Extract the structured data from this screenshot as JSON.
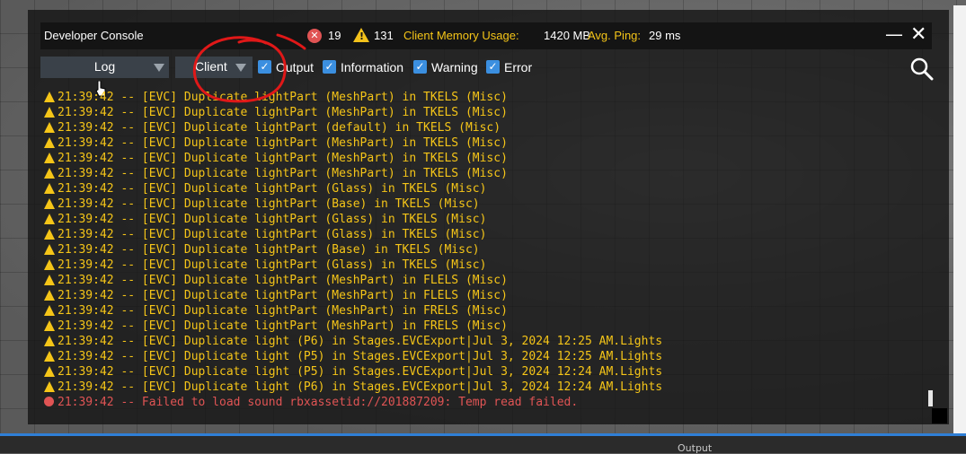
{
  "window": {
    "title": "Developer Console",
    "error_count": "19",
    "warning_count": "131",
    "memory_label": "Client Memory Usage:",
    "memory_value": "1420 MB",
    "ping_label": "Avg. Ping:",
    "ping_value": "29 ms",
    "minimize_glyph": "—",
    "close_glyph": "✕"
  },
  "toolbar": {
    "view_dropdown": "Log",
    "source_dropdown": "Client",
    "filters": [
      {
        "label": "Output",
        "checked": true
      },
      {
        "label": "Information",
        "checked": true
      },
      {
        "label": "Warning",
        "checked": true
      },
      {
        "label": "Error",
        "checked": true
      }
    ]
  },
  "log": [
    {
      "type": "warning",
      "text": "21:39:42 -- [EVC] Duplicate lightPart (MeshPart) in TKELS (Misc)"
    },
    {
      "type": "warning",
      "text": "21:39:42 -- [EVC] Duplicate lightPart (MeshPart) in TKELS (Misc)"
    },
    {
      "type": "warning",
      "text": "21:39:42 -- [EVC] Duplicate lightPart (default) in TKELS (Misc)"
    },
    {
      "type": "warning",
      "text": "21:39:42 -- [EVC] Duplicate lightPart (MeshPart) in TKELS (Misc)"
    },
    {
      "type": "warning",
      "text": "21:39:42 -- [EVC] Duplicate lightPart (MeshPart) in TKELS (Misc)"
    },
    {
      "type": "warning",
      "text": "21:39:42 -- [EVC] Duplicate lightPart (MeshPart) in TKELS (Misc)"
    },
    {
      "type": "warning",
      "text": "21:39:42 -- [EVC] Duplicate lightPart (Glass) in TKELS (Misc)"
    },
    {
      "type": "warning",
      "text": "21:39:42 -- [EVC] Duplicate lightPart (Base) in TKELS (Misc)"
    },
    {
      "type": "warning",
      "text": "21:39:42 -- [EVC] Duplicate lightPart (Glass) in TKELS (Misc)"
    },
    {
      "type": "warning",
      "text": "21:39:42 -- [EVC] Duplicate lightPart (Glass) in TKELS (Misc)"
    },
    {
      "type": "warning",
      "text": "21:39:42 -- [EVC] Duplicate lightPart (Base) in TKELS (Misc)"
    },
    {
      "type": "warning",
      "text": "21:39:42 -- [EVC] Duplicate lightPart (Glass) in TKELS (Misc)"
    },
    {
      "type": "warning",
      "text": "21:39:42 -- [EVC] Duplicate lightPart (MeshPart) in FLELS (Misc)"
    },
    {
      "type": "warning",
      "text": "21:39:42 -- [EVC] Duplicate lightPart (MeshPart) in FLELS (Misc)"
    },
    {
      "type": "warning",
      "text": "21:39:42 -- [EVC] Duplicate lightPart (MeshPart) in FRELS (Misc)"
    },
    {
      "type": "warning",
      "text": "21:39:42 -- [EVC] Duplicate lightPart (MeshPart) in FRELS (Misc)"
    },
    {
      "type": "warning",
      "text": "21:39:42 -- [EVC] Duplicate light (P6) in Stages.EVCExport|Jul 3, 2024 12:25 AM.Lights"
    },
    {
      "type": "warning",
      "text": "21:39:42 -- [EVC] Duplicate light (P5) in Stages.EVCExport|Jul 3, 2024 12:25 AM.Lights"
    },
    {
      "type": "warning",
      "text": "21:39:42 -- [EVC] Duplicate light (P5) in Stages.EVCExport|Jul 3, 2024 12:24 AM.Lights"
    },
    {
      "type": "warning",
      "text": "21:39:42 -- [EVC] Duplicate light (P6) in Stages.EVCExport|Jul 3, 2024 12:24 AM.Lights"
    },
    {
      "type": "error",
      "text": "21:39:42 -- Failed to load sound rbxassetid://201887209: Temp read failed."
    }
  ],
  "bottom_panel": {
    "label": "Output"
  },
  "colors": {
    "warning": "#f5c518",
    "error": "#e05454",
    "accent": "#3b8fe0",
    "annotation": "#e01818"
  }
}
